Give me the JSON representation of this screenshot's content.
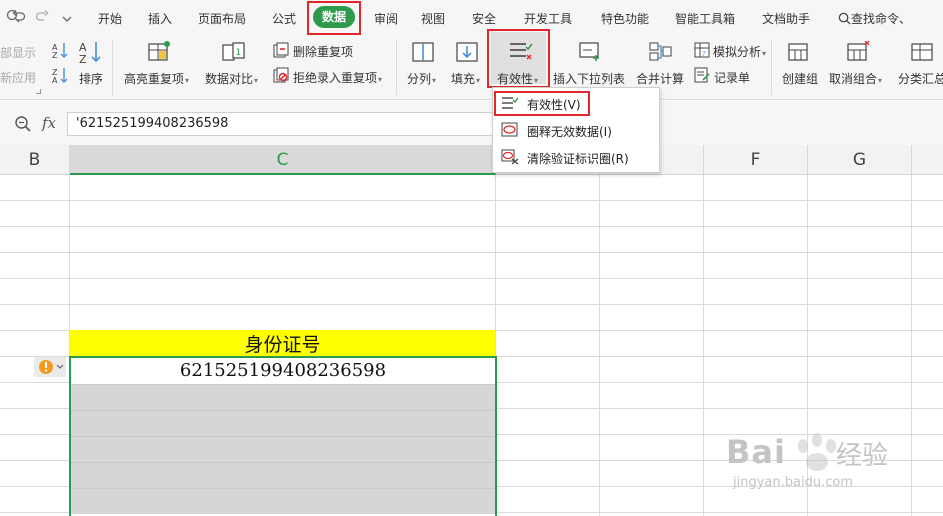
{
  "menubar": {
    "items": [
      "开始",
      "插入",
      "页面布局",
      "公式",
      "数据",
      "审阅",
      "视图",
      "安全",
      "开发工具",
      "特色功能",
      "智能工具箱",
      "文档助手"
    ],
    "active": "数据",
    "search": "查找命令、"
  },
  "ribbon": {
    "partial_left_top": "部显示",
    "partial_left_bottom": "新应用",
    "sort": "排序",
    "highlight_dup": "高亮重复项",
    "data_compare": "数据对比",
    "delete_dup": "删除重复项",
    "reject_dup": "拒绝录入重复项",
    "split_col": "分列",
    "fill": "填充",
    "validity": "有效性",
    "insert_dropdown": "插入下拉列表",
    "consolidate": "合并计算",
    "simulate": "模拟分析",
    "record_form": "记录单",
    "create_group": "创建组",
    "ungroup": "取消组合",
    "subtotal": "分类汇总"
  },
  "formula_bar": {
    "fx": "fx",
    "value": "'621525199408236598"
  },
  "columns": [
    "B",
    "C",
    "F",
    "G"
  ],
  "cells": {
    "header": "身份证号",
    "id_value": "621525199408236598"
  },
  "dropdown": {
    "items": [
      {
        "label": "有效性(V)"
      },
      {
        "label": "圈释无效数据(I)"
      },
      {
        "label": "清除验证标识圈(R)"
      }
    ]
  },
  "watermark": {
    "brand": "Bai",
    "brand_cn": "经验",
    "url": "jingyan.baidu.com"
  },
  "colors": {
    "accent": "#2e9b4c",
    "highlight_red": "#e3262b",
    "header_yellow": "#ffff00",
    "cell_gray": "#d6d6d6"
  }
}
